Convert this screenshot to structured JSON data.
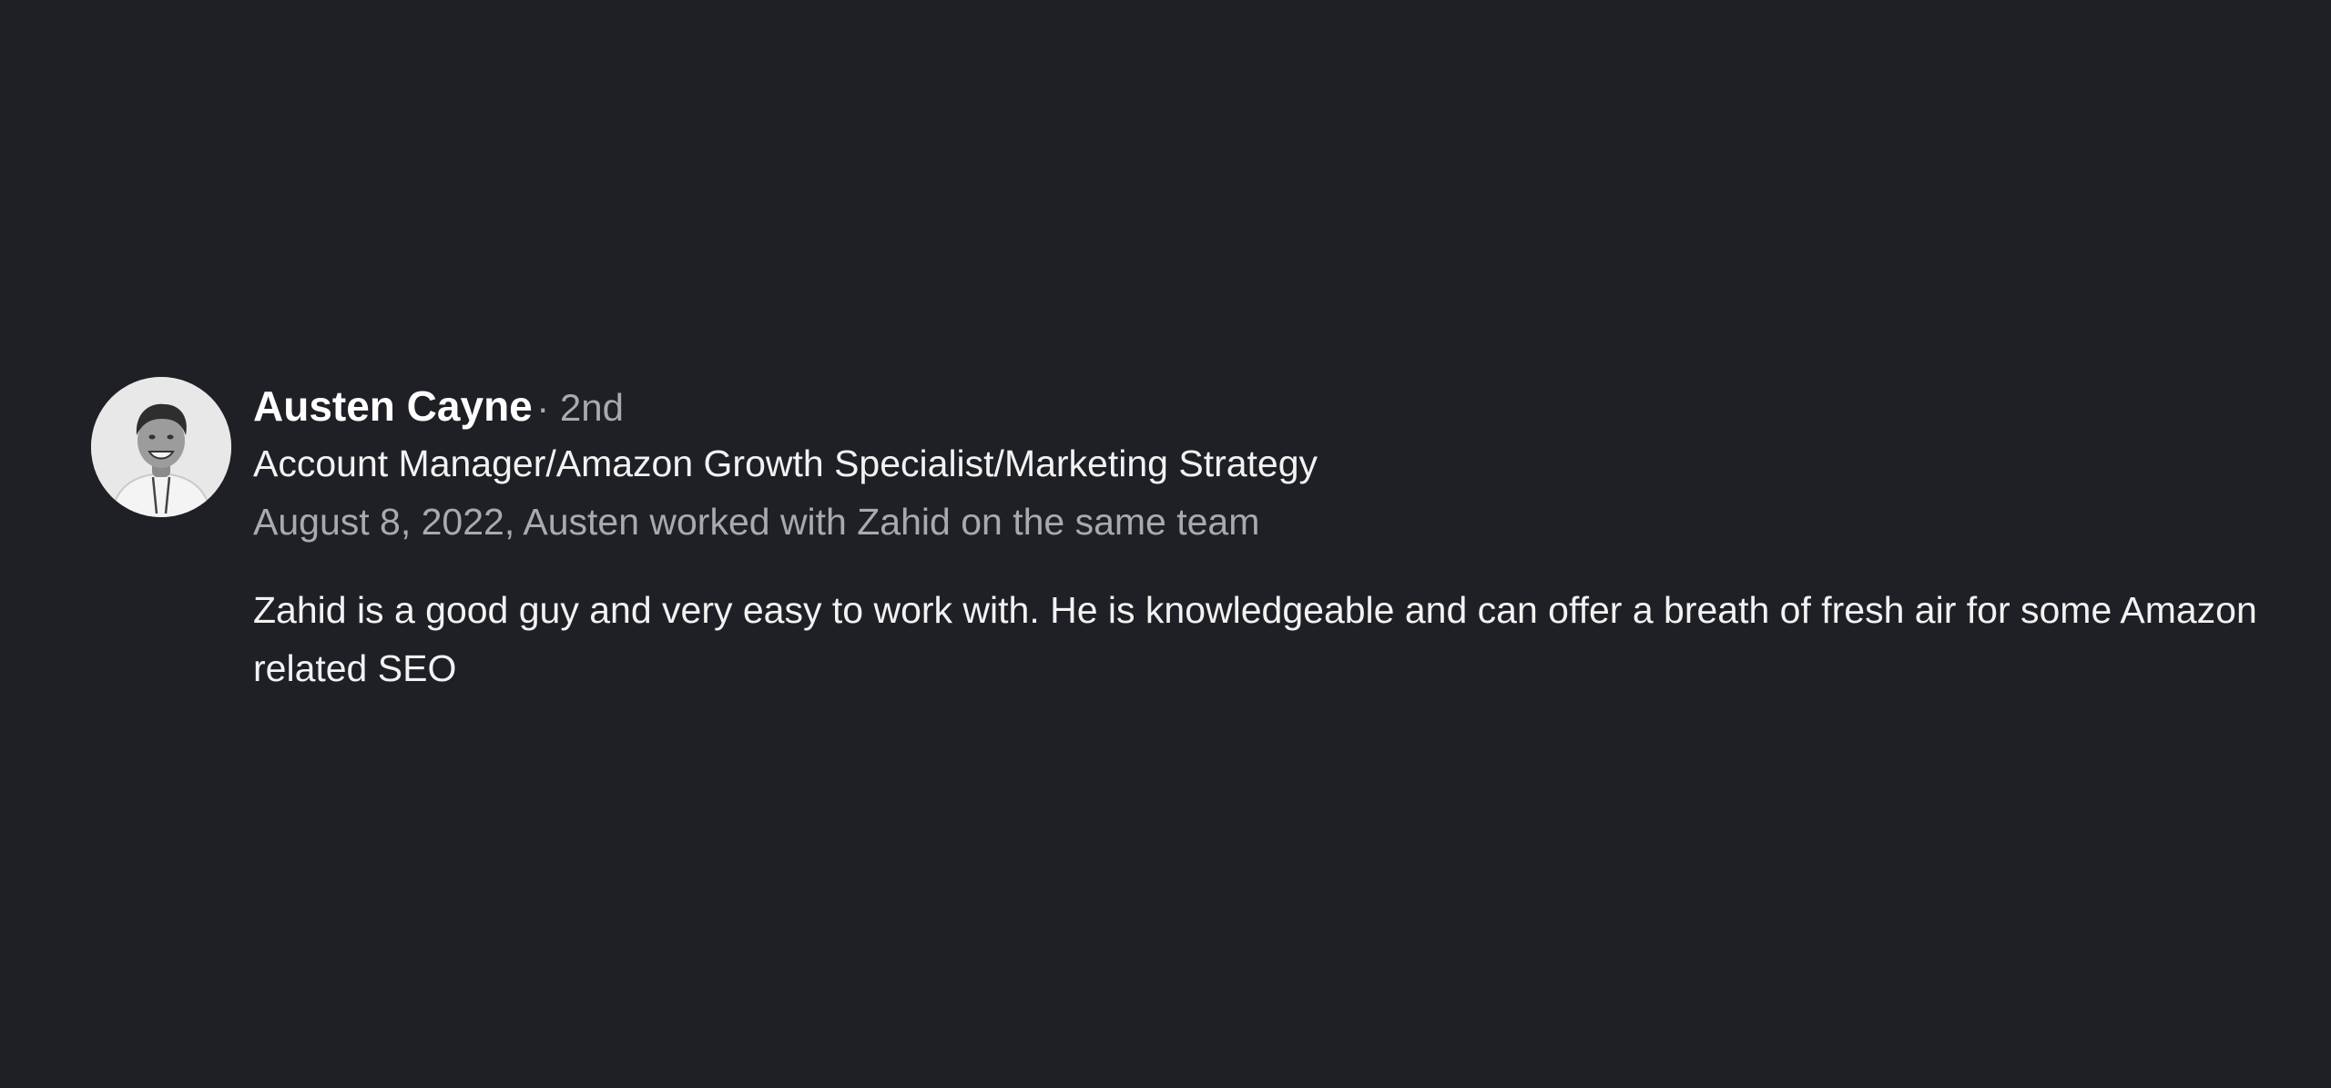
{
  "recommendation": {
    "author": {
      "name": "Austen Cayne",
      "connection_degree": "· 2nd",
      "headline": "Account Manager/Amazon Growth Specialist/Marketing Strategy",
      "avatar_icon": "profile-photo"
    },
    "meta": "August 8, 2022, Austen worked with Zahid on the same team",
    "text": "Zahid is a good guy and very easy to work with. He is knowledgeable and can offer a breath of fresh air for some Amazon related SEO"
  },
  "colors": {
    "background": "#1f2025",
    "primary_text": "#ffffff",
    "secondary_text": "#a9aaad"
  }
}
